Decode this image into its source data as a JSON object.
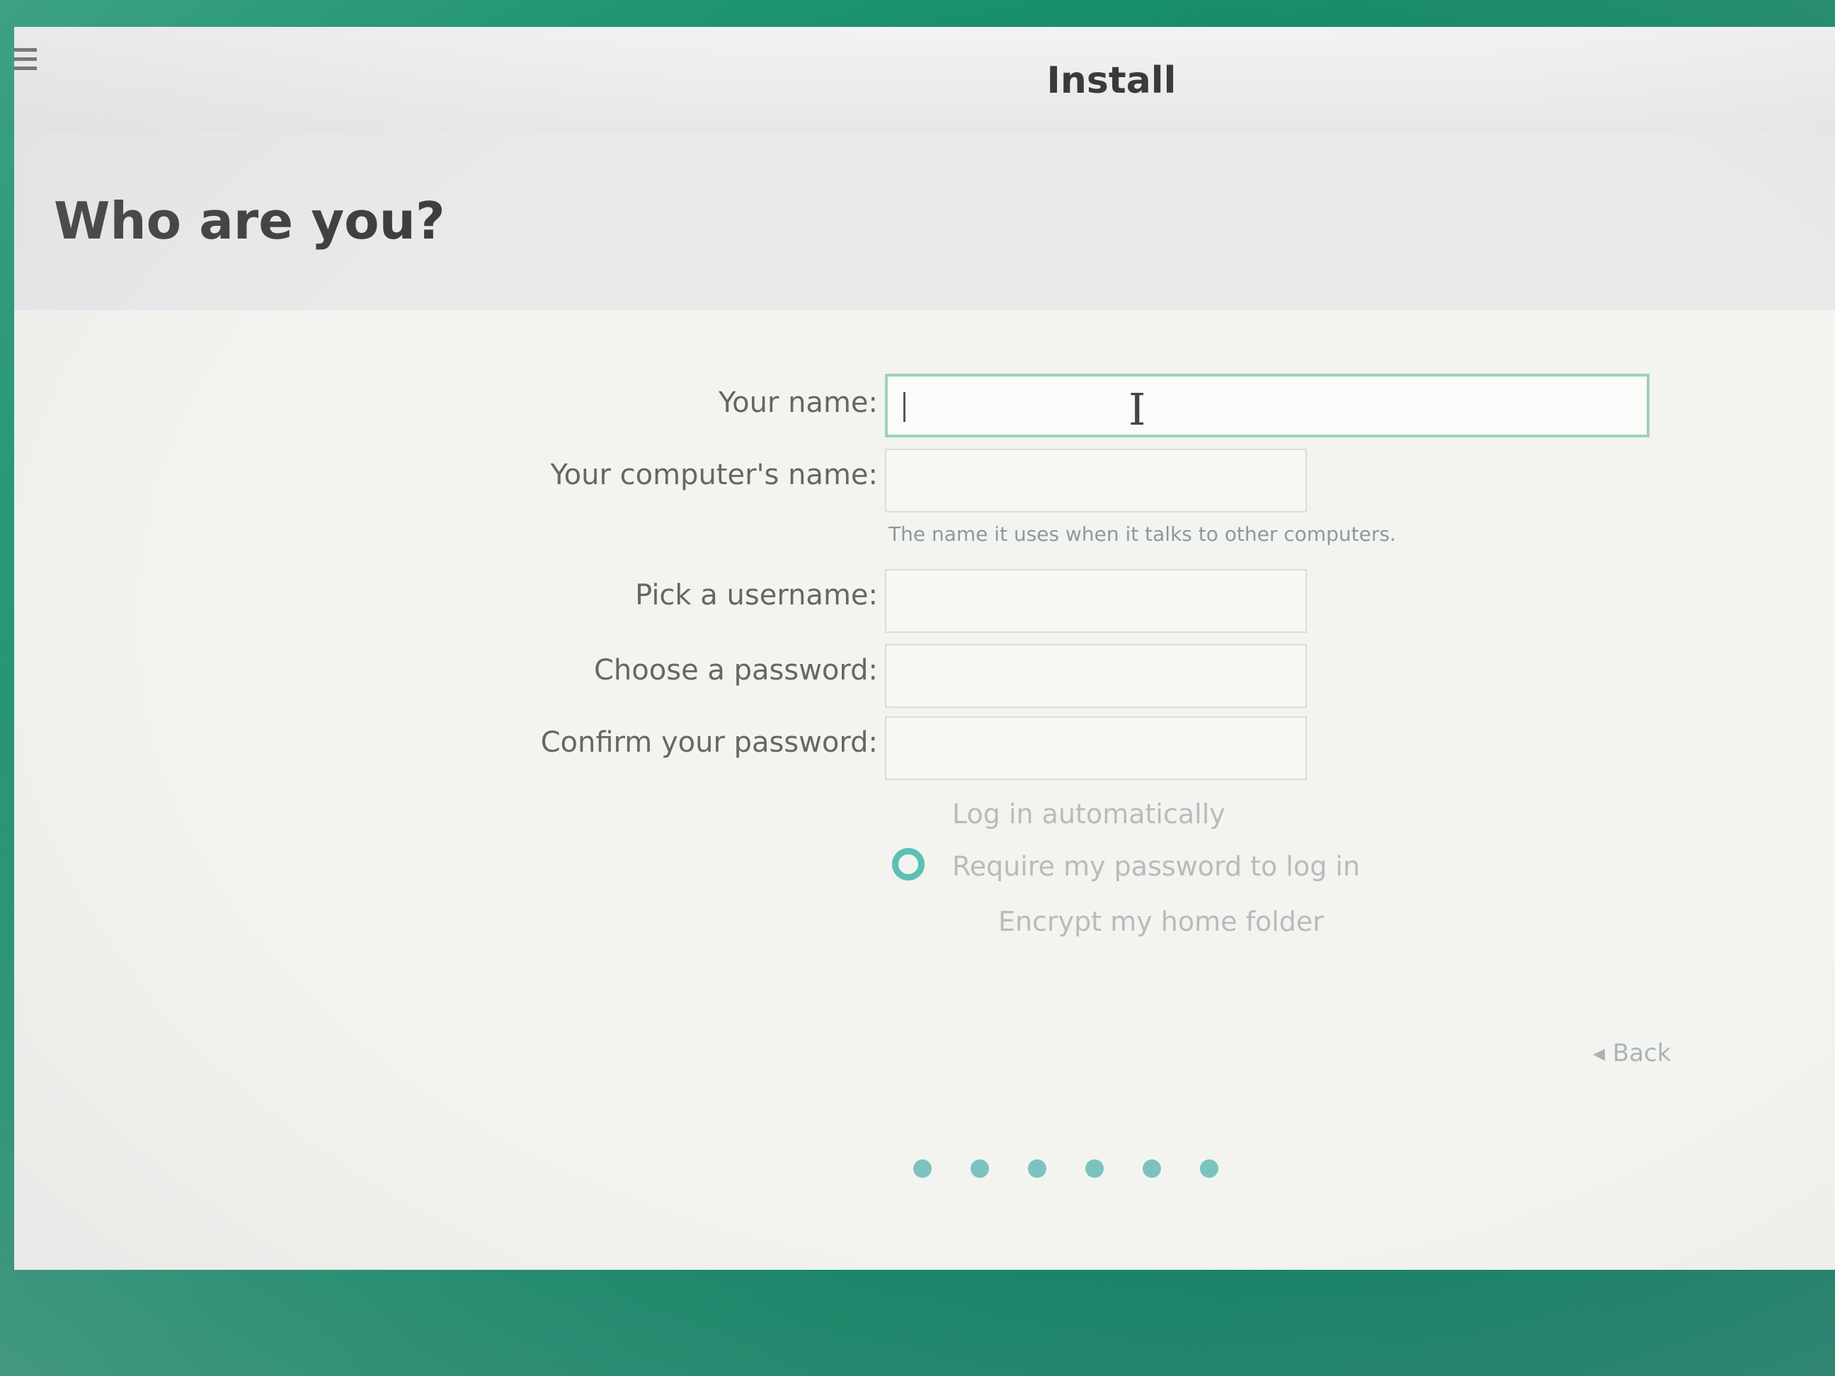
{
  "window": {
    "title": "Install"
  },
  "page": {
    "heading": "Who are you?"
  },
  "form": {
    "name_label": "Your name:",
    "name_value": "",
    "computer_name_label": "Your computer's name:",
    "computer_name_value": "",
    "computer_name_hint": "The name it uses when it talks to other computers.",
    "username_label": "Pick a username:",
    "username_value": "",
    "password_label": "Choose a password:",
    "password_value": "",
    "confirm_password_label": "Confirm your password:",
    "confirm_password_value": ""
  },
  "options": {
    "log_in_automatically": "Log in automatically",
    "require_password": "Require my password to log in",
    "encrypt_home": "Encrypt my home folder",
    "selected": "require_password"
  },
  "navigation": {
    "back_label": "Back",
    "back_icon": "arrow-left-icon"
  },
  "progress": {
    "dots": 6
  },
  "colors": {
    "accent": "#5cc0b2",
    "desktop": "#1a9a72"
  }
}
